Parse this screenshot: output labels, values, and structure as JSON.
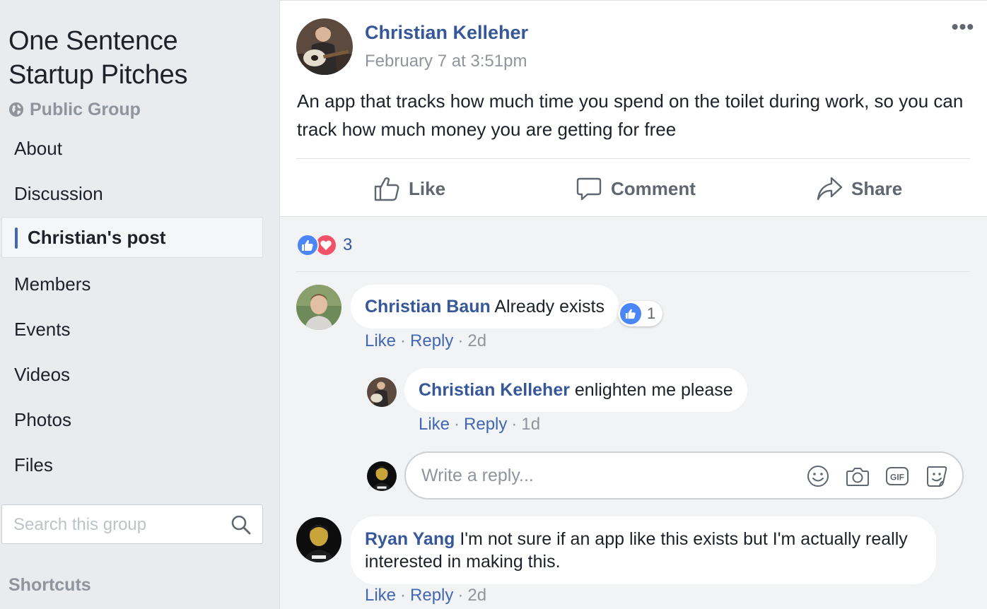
{
  "group": {
    "title": "One Sentence Startup Pitches",
    "privacy": "Public Group"
  },
  "nav": {
    "items": [
      {
        "label": "About"
      },
      {
        "label": "Discussion"
      },
      {
        "label": "Christian's post",
        "active": true
      },
      {
        "label": "Members"
      },
      {
        "label": "Events"
      },
      {
        "label": "Videos"
      },
      {
        "label": "Photos"
      },
      {
        "label": "Files"
      }
    ],
    "search_placeholder": "Search this group",
    "shortcuts_label": "Shortcuts"
  },
  "post": {
    "author": "Christian Kelleher",
    "time": "February 7 at 3:51pm",
    "more": "•••",
    "text": "An app that tracks how much time you spend on the toilet during work, so you can track how much money you are getting for free",
    "actions": {
      "like": "Like",
      "comment": "Comment",
      "share": "Share"
    }
  },
  "reactions": {
    "count": "3",
    "types": [
      "like-icon",
      "love-icon"
    ]
  },
  "comments": [
    {
      "author": "Christian Baun",
      "text": "Already exists",
      "like_count": "1",
      "like": "Like",
      "reply": "Reply",
      "time": "2d",
      "replies": [
        {
          "author": "Christian Kelleher",
          "text": "enlighten me please",
          "like": "Like",
          "reply": "Reply",
          "time": "1d"
        }
      ]
    },
    {
      "author": "Ryan Yang",
      "text": "I'm not sure if an app like this exists but I'm actually really interested in making this.",
      "like": "Like",
      "reply": "Reply",
      "time": "2d"
    }
  ],
  "reply_box": {
    "placeholder": "Write a reply...",
    "tools": [
      "emoji-icon",
      "camera-icon",
      "gif-icon",
      "sticker-icon"
    ]
  },
  "colors": {
    "link": "#365899",
    "muted": "#90949c",
    "like_blue": "#4a86f5",
    "love_red": "#f25268",
    "nav_accent": "#4267b2",
    "page_bg": "#e9ebee"
  },
  "separator": "·"
}
